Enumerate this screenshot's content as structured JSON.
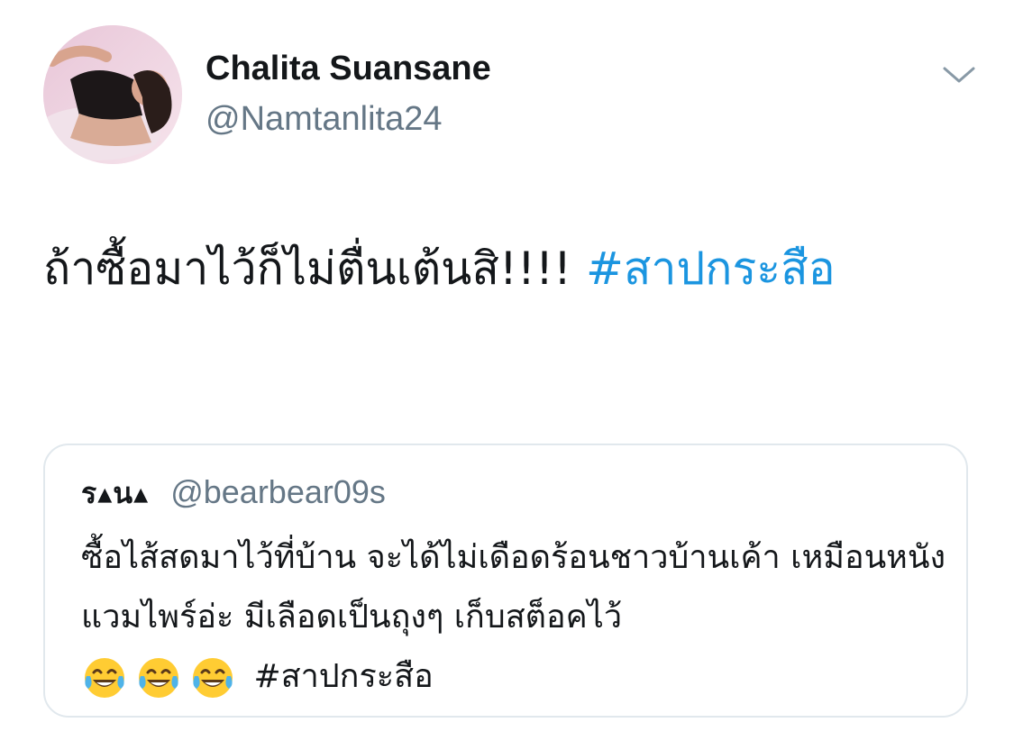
{
  "tweet": {
    "author": {
      "display_name": "Chalita Suansane",
      "handle": "@Namtanlita24"
    },
    "text": "ถ้าซื้อมาไว้ก็ไม่ตื่นเต้นสิ!!!!",
    "hashtag": "#สาปกระสือ",
    "menu_icon": "chevron-down-icon"
  },
  "quoted_tweet": {
    "display_name": "ร▴น▴",
    "handle": "@bearbear09s",
    "text": "ซื้อไส้สดมาไว้ที่บ้าน จะได้ไม่เดือดร้อนชาวบ้านเค้า เหมือนหนังแวมไพร์อ่ะ มีเลือดเป็นถุงๆ เก็บสต็อคไว้",
    "emoji": [
      "face-with-tears-of-joy",
      "face-with-tears-of-joy",
      "face-with-tears-of-joy"
    ],
    "hashtag": "#สาปกระสือ"
  },
  "colors": {
    "text": "#14171a",
    "secondary": "#657786",
    "link": "#1b95e0",
    "border": "#e1e8ed"
  }
}
